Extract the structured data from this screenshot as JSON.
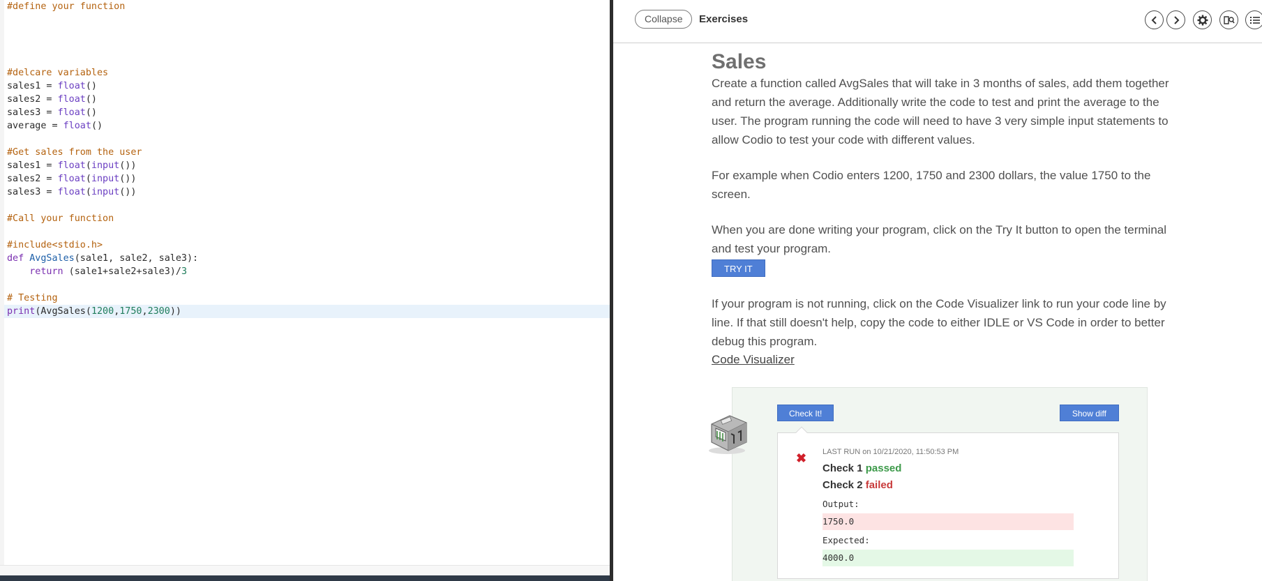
{
  "editor": {
    "lines": [
      [
        {
          "t": "comment",
          "v": "#define your function"
        }
      ],
      [],
      [],
      [],
      [],
      [
        {
          "t": "comment",
          "v": "#delcare variables"
        }
      ],
      [
        {
          "t": "plain",
          "v": "sales1 = "
        },
        {
          "t": "builtin",
          "v": "float"
        },
        {
          "t": "plain",
          "v": "()"
        }
      ],
      [
        {
          "t": "plain",
          "v": "sales2 = "
        },
        {
          "t": "builtin",
          "v": "float"
        },
        {
          "t": "plain",
          "v": "()"
        }
      ],
      [
        {
          "t": "plain",
          "v": "sales3 = "
        },
        {
          "t": "builtin",
          "v": "float"
        },
        {
          "t": "plain",
          "v": "()"
        }
      ],
      [
        {
          "t": "plain",
          "v": "average = "
        },
        {
          "t": "builtin",
          "v": "float"
        },
        {
          "t": "plain",
          "v": "()"
        }
      ],
      [],
      [
        {
          "t": "comment",
          "v": "#Get sales from the user"
        }
      ],
      [
        {
          "t": "plain",
          "v": "sales1 = "
        },
        {
          "t": "builtin",
          "v": "float"
        },
        {
          "t": "plain",
          "v": "("
        },
        {
          "t": "builtin",
          "v": "input"
        },
        {
          "t": "plain",
          "v": "())"
        }
      ],
      [
        {
          "t": "plain",
          "v": "sales2 = "
        },
        {
          "t": "builtin",
          "v": "float"
        },
        {
          "t": "plain",
          "v": "("
        },
        {
          "t": "builtin",
          "v": "input"
        },
        {
          "t": "plain",
          "v": "())"
        }
      ],
      [
        {
          "t": "plain",
          "v": "sales3 = "
        },
        {
          "t": "builtin",
          "v": "float"
        },
        {
          "t": "plain",
          "v": "("
        },
        {
          "t": "builtin",
          "v": "input"
        },
        {
          "t": "plain",
          "v": "())"
        }
      ],
      [],
      [
        {
          "t": "comment",
          "v": "#Call your function"
        }
      ],
      [],
      [
        {
          "t": "comment",
          "v": "#include<stdio.h>"
        }
      ],
      [
        {
          "t": "kw",
          "v": "def "
        },
        {
          "t": "fn",
          "v": "AvgSales"
        },
        {
          "t": "plain",
          "v": "(sale1, sale2, sale3):"
        }
      ],
      [
        {
          "t": "plain",
          "v": "    "
        },
        {
          "t": "kw",
          "v": "return"
        },
        {
          "t": "plain",
          "v": " (sale1+sale2+sale3)/"
        },
        {
          "t": "num",
          "v": "3"
        }
      ],
      [],
      [
        {
          "t": "comment",
          "v": "# Testing"
        }
      ],
      [
        {
          "t": "kw",
          "v": "print"
        },
        {
          "t": "plain",
          "v": "(AvgSales("
        },
        {
          "t": "num",
          "v": "1200"
        },
        {
          "t": "plain",
          "v": ","
        },
        {
          "t": "num",
          "v": "1750"
        },
        {
          "t": "plain",
          "v": ","
        },
        {
          "t": "num",
          "v": "2300"
        },
        {
          "t": "plain",
          "v": "))"
        }
      ]
    ],
    "active_line": 23
  },
  "toolbar": {
    "collapse_label": "Collapse",
    "section_title": "Exercises",
    "icons": [
      "chevron-left-icon",
      "chevron-right-icon",
      "gear-icon",
      "book-search-icon",
      "list-icon"
    ]
  },
  "content": {
    "heading": "Sales",
    "p1": "Create a function called AvgSales that will take in 3 months of sales, add them together and return the average. Additionally write the code to test and print the average to the user. The program running the code will need to have 3 very simple input statements to allow Codio to test your code with different values.",
    "p2": "For example when Codio enters 1200, 1750 and 2300 dollars, the value 1750 to the screen.",
    "p3": "When you are done writing your program, click on the Try It button to open the terminal and test your program.",
    "try_label": "TRY IT",
    "p4": "If your program is not running, click on the Code Visualizer link to run your code line by line. If that still doesn't help, copy the code to either IDLE or VS Code in order to better debug this program.",
    "code_vis_link": "Code Visualizer"
  },
  "check": {
    "check_label": "Check It!",
    "diff_label": "Show diff",
    "last_run_prefix": "LAST RUN",
    "last_run_stamp": "on 10/21/2020, 11:50:53 PM",
    "check1_label": "Check 1",
    "check1_status": "passed",
    "check2_label": "Check 2",
    "check2_status": "failed",
    "output_label": "Output:",
    "output_value": "1750.0",
    "expected_label": "Expected:",
    "expected_value": "4000.0"
  },
  "colors": {
    "accent": "#4f7fd6",
    "passed": "#3d9a4a",
    "failed": "#c83a3a",
    "fail_icon": "#d0202a"
  }
}
